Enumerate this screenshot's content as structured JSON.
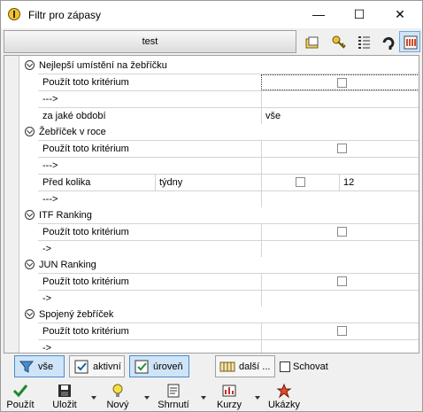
{
  "window": {
    "title": "Filtr pro zápasy",
    "min_symbol": "—",
    "max_symbol": "☐",
    "close_symbol": "✕"
  },
  "header": {
    "name": "test",
    "icons": [
      "folder-icon",
      "key-icon",
      "list-icon",
      "arrow-icon",
      "chart-icon"
    ]
  },
  "groups": [
    {
      "label": "Nejlepší umístění na žebříčku",
      "rows": [
        {
          "label": "Použít toto kritérium",
          "type": "checkbox",
          "checked": false
        },
        {
          "label": "--->",
          "type": "text",
          "value": ""
        },
        {
          "label": "za jaké období",
          "type": "text",
          "value": "vše"
        }
      ]
    },
    {
      "label": "Žebříček v roce",
      "rows": [
        {
          "label": "Použít toto kritérium",
          "type": "checkbox",
          "checked": false
        },
        {
          "label": "--->",
          "type": "text",
          "value": ""
        },
        {
          "label": "Před kolika",
          "sub": "týdny",
          "type": "checkbox-num",
          "checked": false,
          "num": "12"
        },
        {
          "label": "--->",
          "type": "text",
          "value": ""
        }
      ]
    },
    {
      "label": "ITF Ranking",
      "rows": [
        {
          "label": "Použít toto kritérium",
          "type": "checkbox",
          "checked": false
        },
        {
          "label": "->",
          "type": "text",
          "value": ""
        }
      ]
    },
    {
      "label": "JUN Ranking",
      "rows": [
        {
          "label": "Použít toto kritérium",
          "type": "checkbox",
          "checked": false
        },
        {
          "label": "->",
          "type": "text",
          "value": ""
        }
      ]
    },
    {
      "label": "Spojený žebříček",
      "rows": [
        {
          "label": "Použít toto kritérium",
          "type": "checkbox",
          "checked": false
        },
        {
          "label": "->",
          "type": "text",
          "value": ""
        }
      ]
    }
  ],
  "filter_bar": {
    "all": "vše",
    "active": "aktivní",
    "level": "úroveň",
    "more": "další ...",
    "hide": "Schovat"
  },
  "bottom": {
    "apply": "Použít",
    "save": "Uložit",
    "new": "Nový",
    "summary": "Shrnutí",
    "rates": "Kurzy",
    "examples": "Ukázky"
  },
  "colors": {
    "accent": "#cfe4f8",
    "accent_border": "#4a8cc8"
  }
}
